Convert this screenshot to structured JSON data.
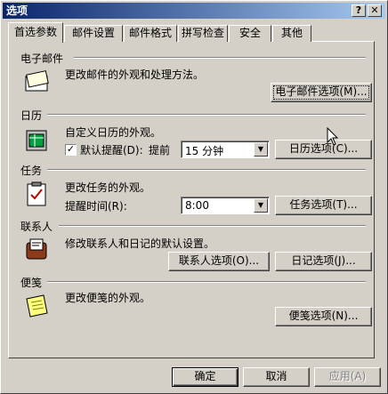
{
  "window": {
    "title": "选项",
    "help_btn": "?",
    "close_btn": "✕"
  },
  "tabs": [
    "首选参数",
    "邮件设置",
    "邮件格式",
    "拼写检查",
    "安全",
    "其他"
  ],
  "email": {
    "title": "电子邮件",
    "desc": "更改邮件的外观和处理方法。",
    "button": "电子邮件选项(M)...",
    "icon": "mail-envelope-icon"
  },
  "calendar": {
    "title": "日历",
    "desc": "自定义日历的外观。",
    "reminder_checked": true,
    "reminder_label": "默认提醒(D):",
    "ahead_label": "提前",
    "reminder_value": "15 分钟",
    "button": "日历选项(C)...",
    "icon": "calendar-icon"
  },
  "tasks": {
    "title": "任务",
    "desc": "更改任务的外观。",
    "time_label": "提醒时间(R):",
    "time_value": "8:00",
    "button": "任务选项(T)...",
    "icon": "task-clipboard-icon"
  },
  "contacts": {
    "title": "联系人",
    "desc": "修改联系人和日记的默认设置。",
    "button1": "联系人选项(O)...",
    "button2": "日记选项(J)...",
    "icon": "contacts-rolodex-icon"
  },
  "notes": {
    "title": "便笺",
    "desc": "更改便笺的外观。",
    "button": "便笺选项(N)...",
    "icon": "note-pad-icon"
  },
  "footer": {
    "ok": "确定",
    "cancel": "取消",
    "apply": "应用(A)"
  }
}
